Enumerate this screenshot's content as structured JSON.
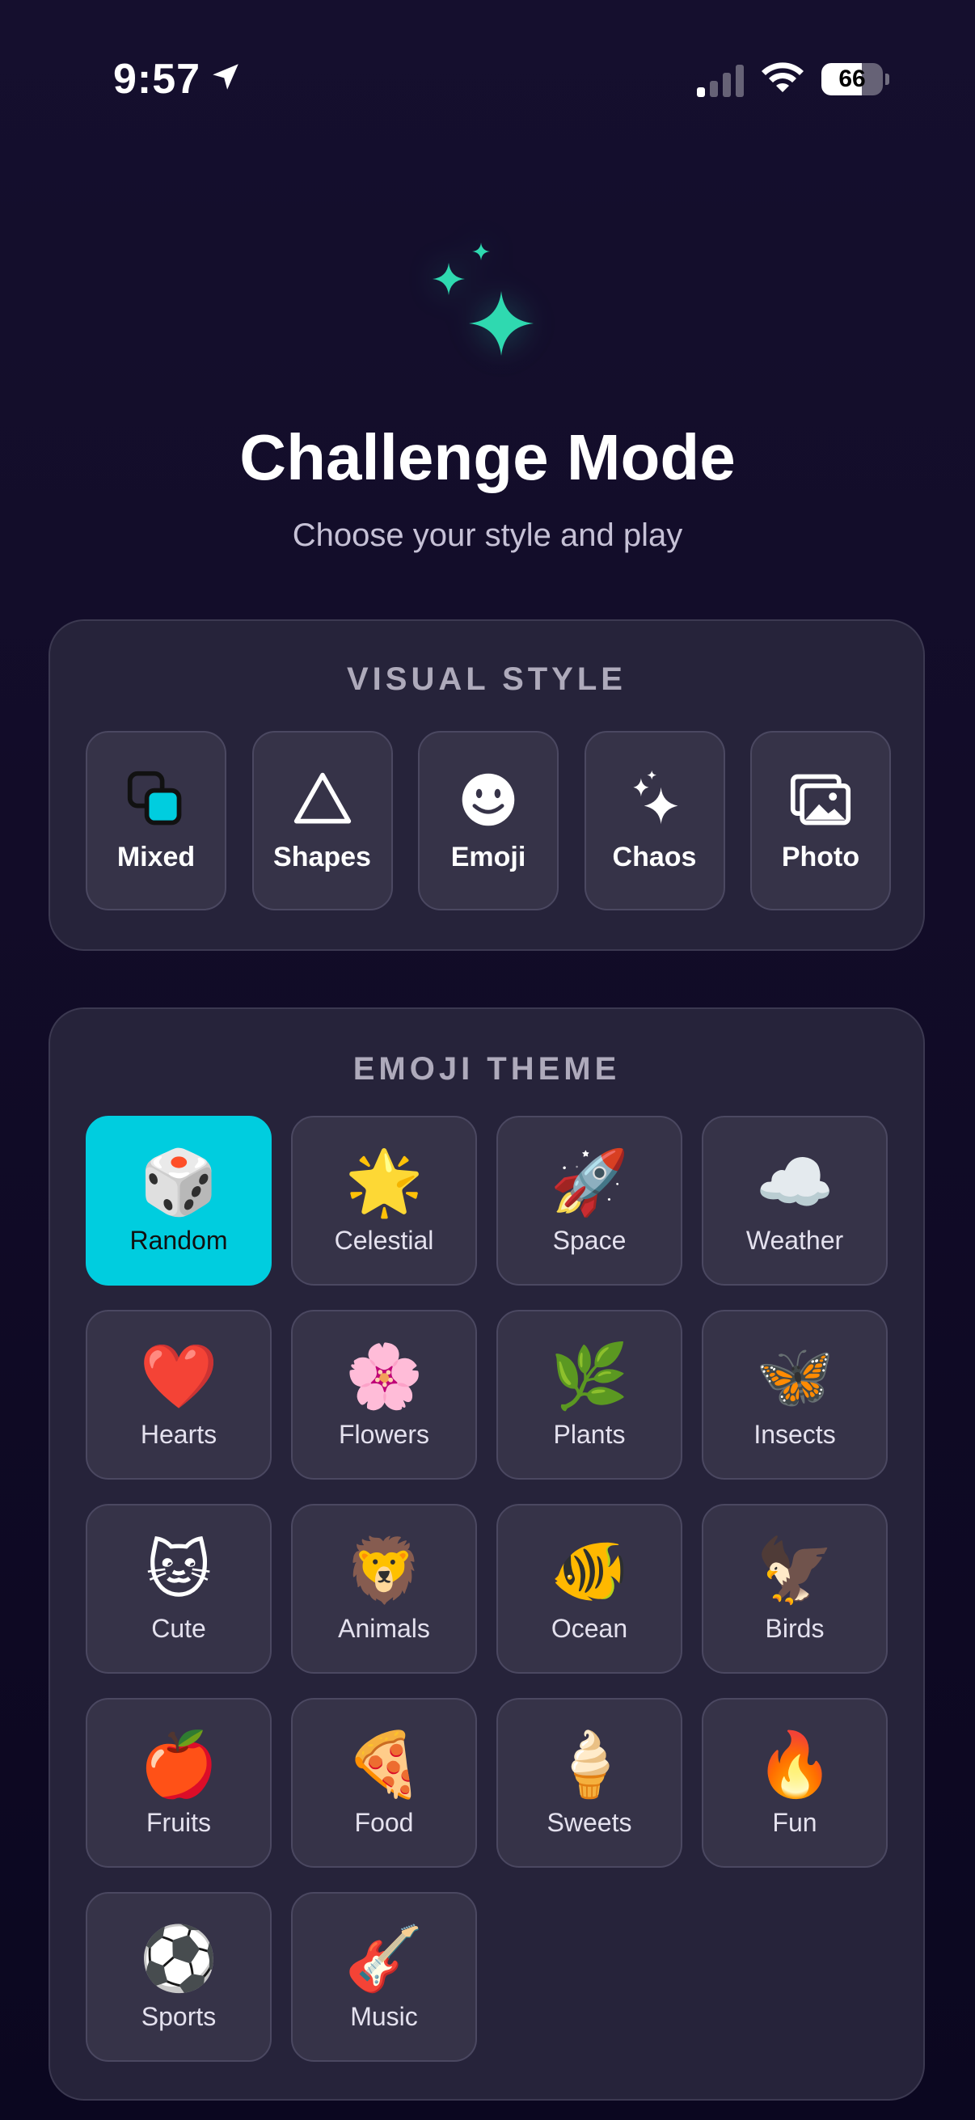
{
  "status_bar": {
    "time": "9:57",
    "battery": "66",
    "battery_level": 0.66
  },
  "hero": {
    "title": "Challenge Mode",
    "subtitle": "Choose your style and play",
    "accent": "#2fd9b0"
  },
  "visual_style": {
    "title": "VISUAL STYLE",
    "selected": "Mixed",
    "options": [
      {
        "label": "Mixed",
        "icon": "overlapping-squares-icon",
        "active": true
      },
      {
        "label": "Shapes",
        "icon": "triangle-icon",
        "active": false
      },
      {
        "label": "Emoji",
        "icon": "smiley-icon",
        "active": false
      },
      {
        "label": "Chaos",
        "icon": "sparkles-icon",
        "active": false
      },
      {
        "label": "Photo",
        "icon": "photos-icon",
        "active": false
      }
    ]
  },
  "emoji_theme": {
    "title": "EMOJI THEME",
    "selected": "Random",
    "options": [
      {
        "label": "Random",
        "emoji": "🎲",
        "active": true
      },
      {
        "label": "Celestial",
        "emoji": "🌟",
        "active": false
      },
      {
        "label": "Space",
        "emoji": "🚀",
        "active": false
      },
      {
        "label": "Weather",
        "emoji": "☁️",
        "active": false
      },
      {
        "label": "Hearts",
        "emoji": "❤️",
        "active": false
      },
      {
        "label": "Flowers",
        "emoji": "🌸",
        "active": false
      },
      {
        "label": "Plants",
        "emoji": "🌿",
        "active": false
      },
      {
        "label": "Insects",
        "emoji": "🦋",
        "active": false
      },
      {
        "label": "Cute",
        "emoji": "🐱",
        "active": false
      },
      {
        "label": "Animals",
        "emoji": "🦁",
        "active": false
      },
      {
        "label": "Ocean",
        "emoji": "🐠",
        "active": false
      },
      {
        "label": "Birds",
        "emoji": "🦅",
        "active": false
      },
      {
        "label": "Fruits",
        "emoji": "🍎",
        "active": false
      },
      {
        "label": "Food",
        "emoji": "🍕",
        "active": false
      },
      {
        "label": "Sweets",
        "emoji": "🍦",
        "active": false
      },
      {
        "label": "Fun",
        "emoji": "🔥",
        "active": false
      },
      {
        "label": "Sports",
        "emoji": "⚽",
        "active": false
      },
      {
        "label": "Music",
        "emoji": "🎸",
        "active": false
      }
    ]
  },
  "colors": {
    "selected": "#00cddf",
    "card": "#26233a",
    "tile": "#363348",
    "background": "#150f2e"
  }
}
